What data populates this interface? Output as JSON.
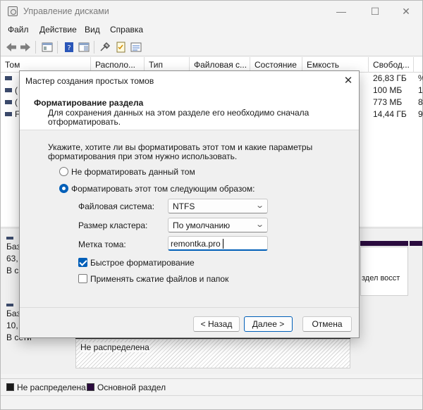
{
  "window": {
    "title": "Управление дисками",
    "menu": [
      "Файл",
      "Действие",
      "Вид",
      "Справка"
    ]
  },
  "volume_list": {
    "columns": [
      "Том",
      "Располо...",
      "Тип",
      "Файловая с...",
      "Состояние",
      "Емкость",
      "Свобод..."
    ],
    "rows": [
      {
        "name": "",
        "free": "26,83 ГБ"
      },
      {
        "name": "(",
        "free": "100 МБ"
      },
      {
        "name": "(",
        "free": "773 МБ"
      },
      {
        "name": "F",
        "free": "14,44 ГБ"
      }
    ],
    "cutoff_right": [
      "%",
      "1",
      "8",
      "9"
    ]
  },
  "disk_map": {
    "disk1_lines": [
      "Баз",
      "63,",
      "В с"
    ],
    "disk2_lines": [
      "Баз",
      "10,",
      "В сети"
    ],
    "recovery_partition_text": "здел восст",
    "unallocated_partition_text": "Не распределена"
  },
  "legend": {
    "unallocated": "Не распределена",
    "primary": "Основной раздел"
  },
  "wizard": {
    "title": "Мастер создания простых томов",
    "close_symbol": "✕",
    "header_title": "Форматирование раздела",
    "header_desc": "Для сохранения данных на этом разделе его необходимо сначала отформатировать.",
    "intro": "Укажите, хотите ли вы форматировать этот том и какие параметры форматирования при этом нужно использовать.",
    "option_no_format": "Не форматировать данный том",
    "option_format": "Форматировать этот том следующим образом:",
    "selected_option": "format",
    "fs_label": "Файловая система:",
    "fs_value": "NTFS",
    "cluster_label": "Размер кластера:",
    "cluster_value": "По умолчанию",
    "volume_label_label": "Метка тома:",
    "volume_label_value": "remontka.pro",
    "quick_format_label": "Быстрое форматирование",
    "quick_format_checked": true,
    "compression_label": "Применять сжатие файлов и папок",
    "compression_checked": false,
    "back_button": "< Назад",
    "next_button": "Далее >",
    "cancel_button": "Отмена"
  },
  "colors": {
    "accent": "#005fb8",
    "primary_partition": "#2a0b3e",
    "unallocated": "#1a1a1a"
  }
}
